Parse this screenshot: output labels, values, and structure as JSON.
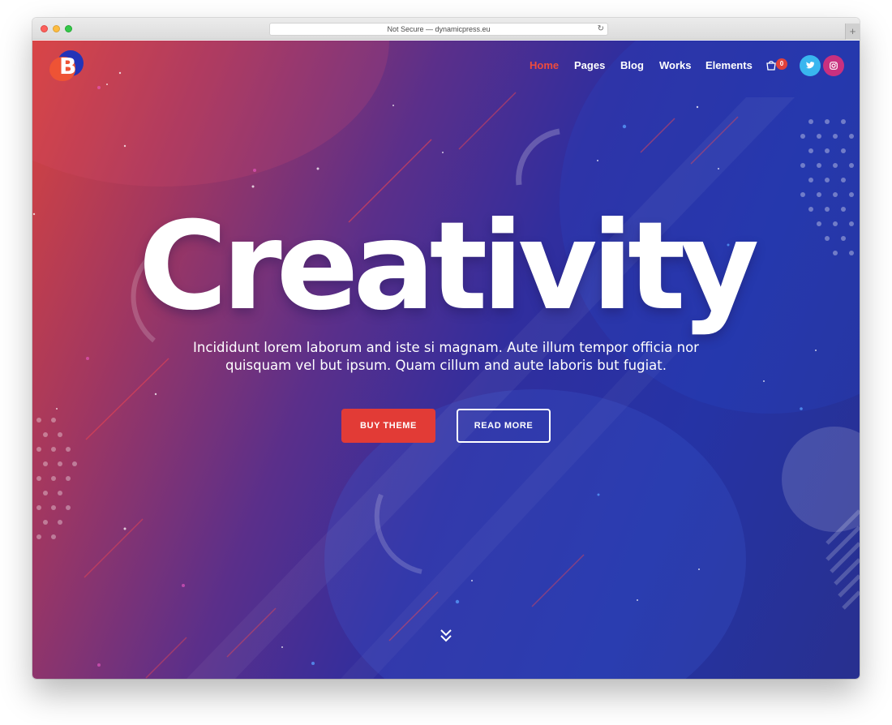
{
  "browser": {
    "address": "Not Secure — dynamicpress.eu",
    "reload_icon": "reload-icon",
    "new_tab_label": "+"
  },
  "site": {
    "logo_letter": "B",
    "nav": [
      {
        "label": "Home",
        "active": true
      },
      {
        "label": "Pages",
        "active": false
      },
      {
        "label": "Blog",
        "active": false
      },
      {
        "label": "Works",
        "active": false
      },
      {
        "label": "Elements",
        "active": false
      }
    ],
    "cart_count": "0",
    "social": {
      "twitter_icon": "twitter-icon",
      "instagram_icon": "instagram-icon"
    }
  },
  "hero": {
    "headline": "Creativity",
    "subtitle_line1": "Incididunt lorem laborum and iste si magnam. Aute illum tempor officia nor",
    "subtitle_line2": "quisquam vel but ipsum. Quam cillum and aute laboris but fugiat.",
    "primary_button": "BUY THEME",
    "secondary_button": "READ MORE",
    "scroll_icon": "chevron-double-down-icon"
  },
  "colors": {
    "accent_red": "#e23b36",
    "active_nav": "#ee4b3d",
    "gradient_start": "#d8443e",
    "gradient_end": "#2533a5",
    "twitter": "#39b6ef",
    "instagram": "#c9307f"
  }
}
